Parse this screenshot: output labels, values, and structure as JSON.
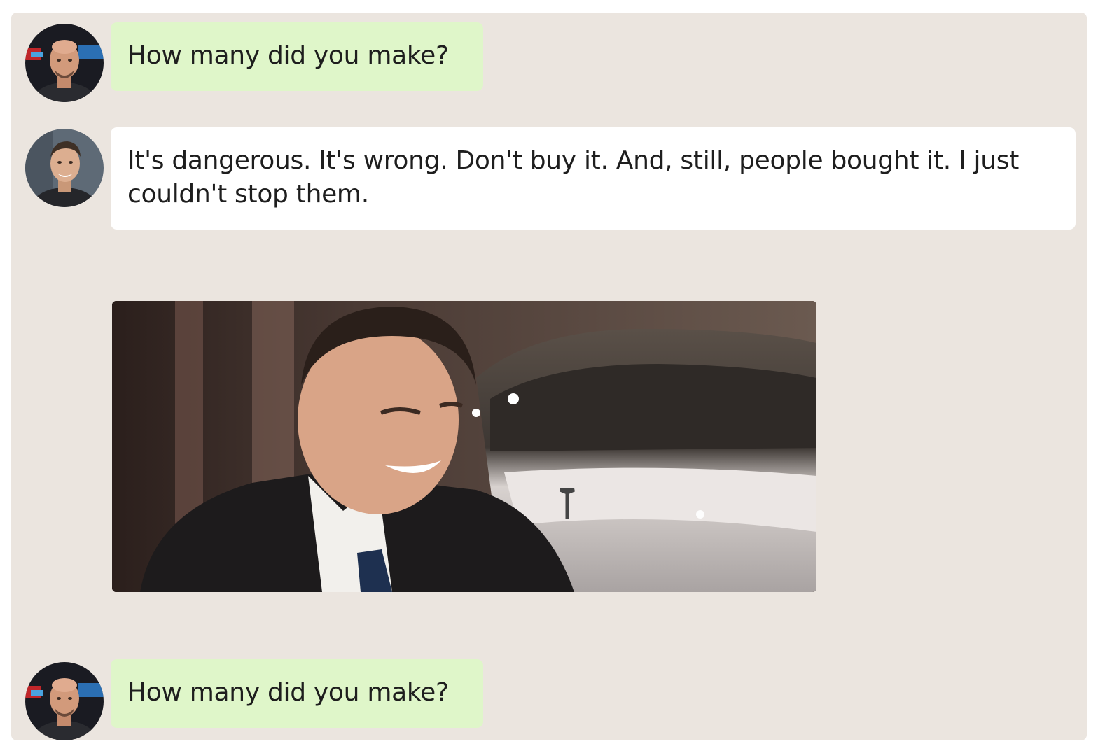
{
  "chat": {
    "messages": [
      {
        "sender": "joe",
        "type": "text",
        "text": "How many did you make?"
      },
      {
        "sender": "elon",
        "type": "text",
        "text": "It's dangerous. It's wrong. Don't buy it. And, still, people bought it. I just couldn't stop them."
      },
      {
        "sender": "elon",
        "type": "gif",
        "subject": "laughing-man-in-suit-beside-tesla-car"
      },
      {
        "sender": "joe",
        "type": "text",
        "text": "How many did you make?"
      }
    ]
  },
  "colors": {
    "chat_background": "#ebe5df",
    "sent_bubble": "#dff6c9",
    "received_bubble": "#ffffff",
    "text": "#1e1e1e"
  }
}
